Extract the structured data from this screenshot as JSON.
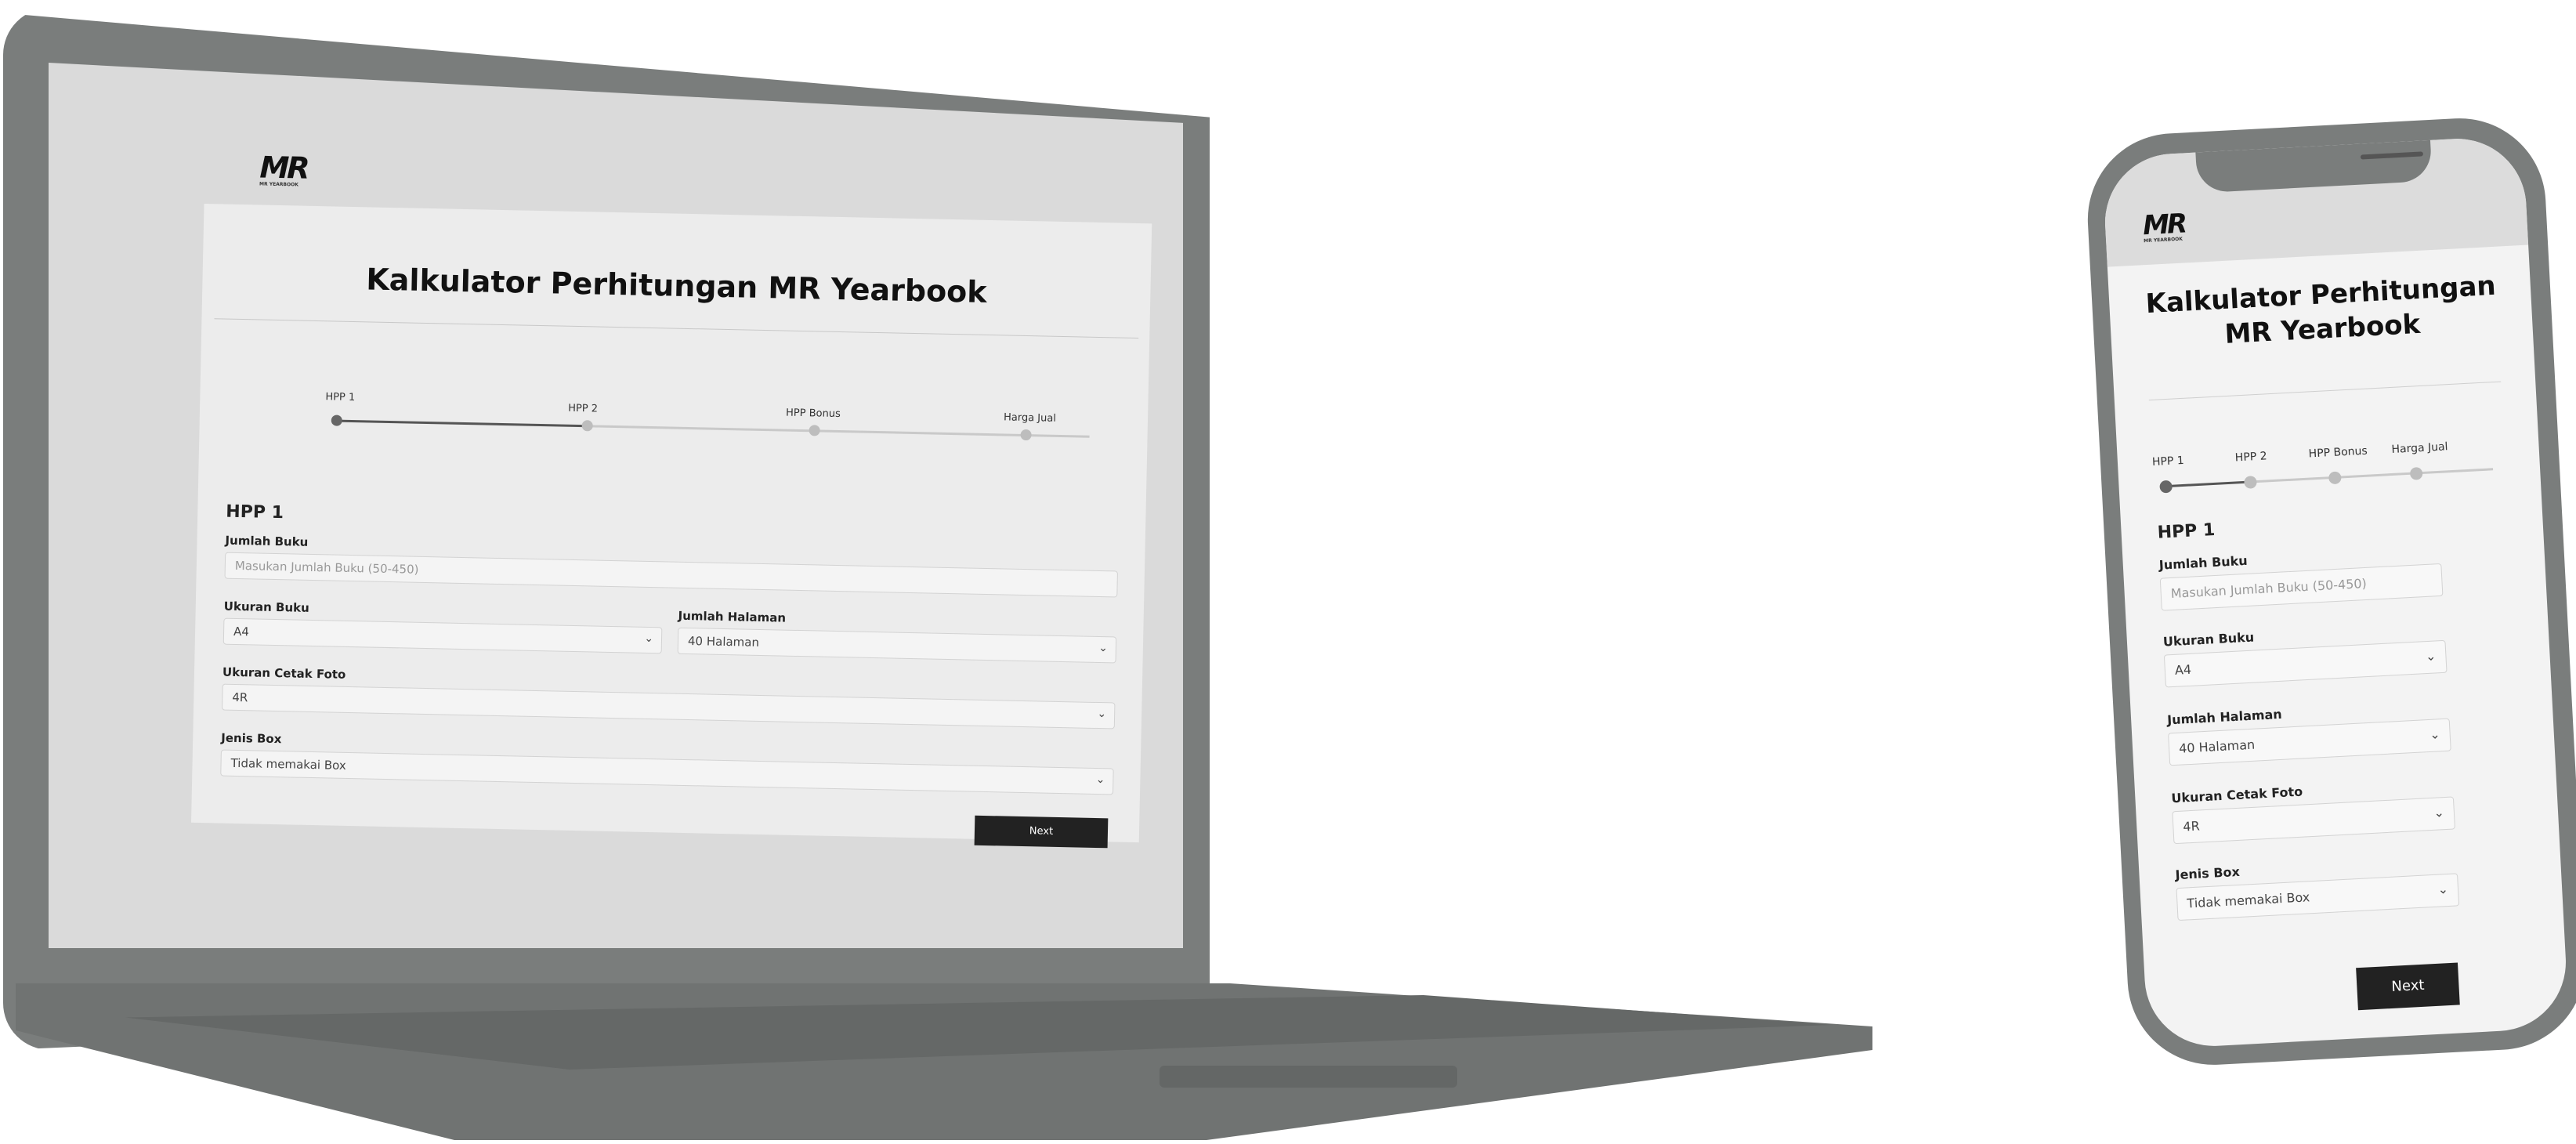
{
  "brand": {
    "logo_text": "MR",
    "logo_subtext": "MR YEARBOOK"
  },
  "page": {
    "title": "Kalkulator Perhitungan MR Yearbook"
  },
  "steps": [
    {
      "label": "HPP 1",
      "active": true
    },
    {
      "label": "HPP 2",
      "active": false
    },
    {
      "label": "HPP Bonus",
      "active": false
    },
    {
      "label": "Harga Jual",
      "active": false
    }
  ],
  "form": {
    "section_title": "HPP 1",
    "jumlah_buku": {
      "label": "Jumlah Buku",
      "placeholder": "Masukan Jumlah Buku (50-450)",
      "value": ""
    },
    "ukuran_buku": {
      "label": "Ukuran Buku",
      "value": "A4"
    },
    "jumlah_halaman": {
      "label": "Jumlah Halaman",
      "value": "40 Halaman"
    },
    "ukuran_cetak_foto": {
      "label": "Ukuran Cetak Foto",
      "value": "4R"
    },
    "jenis_box": {
      "label": "Jenis Box",
      "value": "Tidak memakai Box"
    },
    "next_label": "Next"
  },
  "icons": {
    "dropdown": "chevron-down-icon"
  },
  "colors": {
    "button": "#222222",
    "device": "#7a7d7c",
    "screen_bg": "#dadada"
  }
}
